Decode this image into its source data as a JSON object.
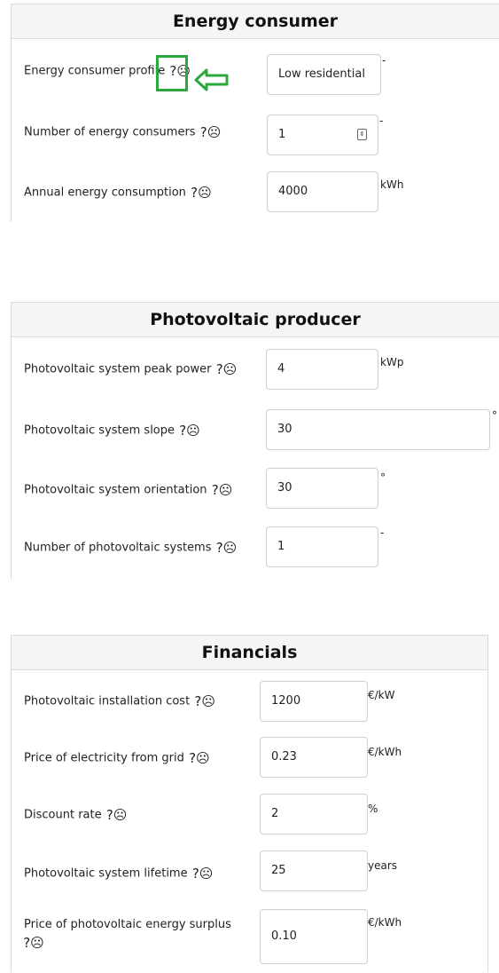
{
  "energy_consumer": {
    "title": "Energy consumer",
    "rows": [
      {
        "label": "Energy consumer profile",
        "value": "Low residential",
        "unit": "-"
      },
      {
        "label": "Number of energy consumers",
        "value": "1",
        "unit": "-"
      },
      {
        "label": "Annual energy consumption",
        "value": "4000",
        "unit": "kWh"
      }
    ]
  },
  "pv_producer": {
    "title": "Photovoltaic producer",
    "rows": [
      {
        "label": "Photovoltaic system peak power",
        "value": "4",
        "unit": "kWp"
      },
      {
        "label": "Photovoltaic system slope",
        "value": "30",
        "unit": "°"
      },
      {
        "label": "Photovoltaic system orientation",
        "value": "30",
        "unit": "°"
      },
      {
        "label": "Number of photovoltaic systems",
        "value": "1",
        "unit": "-"
      }
    ]
  },
  "financials": {
    "title": "Financials",
    "rows": [
      {
        "label": "Photovoltaic installation cost",
        "value": "1200",
        "unit": "€/kW"
      },
      {
        "label": "Price of electricity from grid",
        "value": "0.23",
        "unit": "€/kWh"
      },
      {
        "label": "Discount rate",
        "value": "2",
        "unit": "%"
      },
      {
        "label": "Photovoltaic system lifetime",
        "value": "25",
        "unit": "years"
      },
      {
        "label": "Price of photovoltaic energy surplus",
        "value": "0.10",
        "unit": "€/kWh"
      }
    ]
  },
  "icons": {
    "help": "help-face-icon",
    "arrow": "left-arrow-icon"
  },
  "colors": {
    "highlight": "#2aa83c",
    "header_bg": "#f5f5f5"
  }
}
